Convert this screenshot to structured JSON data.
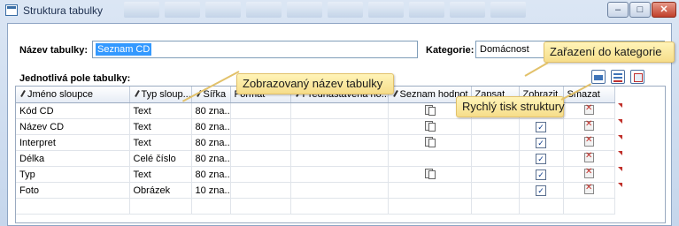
{
  "window": {
    "title": "Struktura tabulky",
    "minimize_glyph": "–",
    "maximize_glyph": "□",
    "close_glyph": "✕"
  },
  "form": {
    "name_label": "Název tabulky:",
    "name_value": "Seznam CD",
    "category_label": "Kategorie:",
    "category_value": "Domácnost",
    "fields_label": "Jednotlivá pole tabulky:"
  },
  "toolbar": {
    "icons": [
      "print-structure-icon",
      "structure-list-icon",
      "structure-export-icon"
    ]
  },
  "grid": {
    "columns": [
      "Jméno sloupce",
      "Typ sloup...",
      "Šířka",
      "Formát",
      "Přednastavená ho...",
      "Seznam hodnot",
      "Zapsat",
      "Zobrazit",
      "Smazat"
    ],
    "rows": [
      {
        "name": "Kód CD",
        "type": "Text",
        "width": "80 zna...",
        "format": "",
        "default": "",
        "list": true,
        "show": "✓"
      },
      {
        "name": "Název CD",
        "type": "Text",
        "width": "80 zna...",
        "format": "",
        "default": "",
        "list": true,
        "show": "✓"
      },
      {
        "name": "Interpret",
        "type": "Text",
        "width": "80 zna...",
        "format": "",
        "default": "",
        "list": true,
        "show": "✓"
      },
      {
        "name": "Délka",
        "type": "Celé číslo",
        "width": "80 zna...",
        "format": "",
        "default": "",
        "list": false,
        "show": "✓"
      },
      {
        "name": "Typ",
        "type": "Text",
        "width": "80 zna...",
        "format": "",
        "default": "",
        "list": true,
        "show": "✓"
      },
      {
        "name": "Foto",
        "type": "Obrázek",
        "width": "10 zna...",
        "format": "",
        "default": "",
        "list": false,
        "show": "✓"
      }
    ]
  },
  "callouts": {
    "table_name": "Zobrazovaný název tabulky",
    "category": "Zařazení do kategorie",
    "print": "Rychlý tisk struktury"
  },
  "colors": {
    "selection": "#3399ff",
    "callout_bg": "#f8e49a",
    "delete_marker": "#c0302a"
  }
}
